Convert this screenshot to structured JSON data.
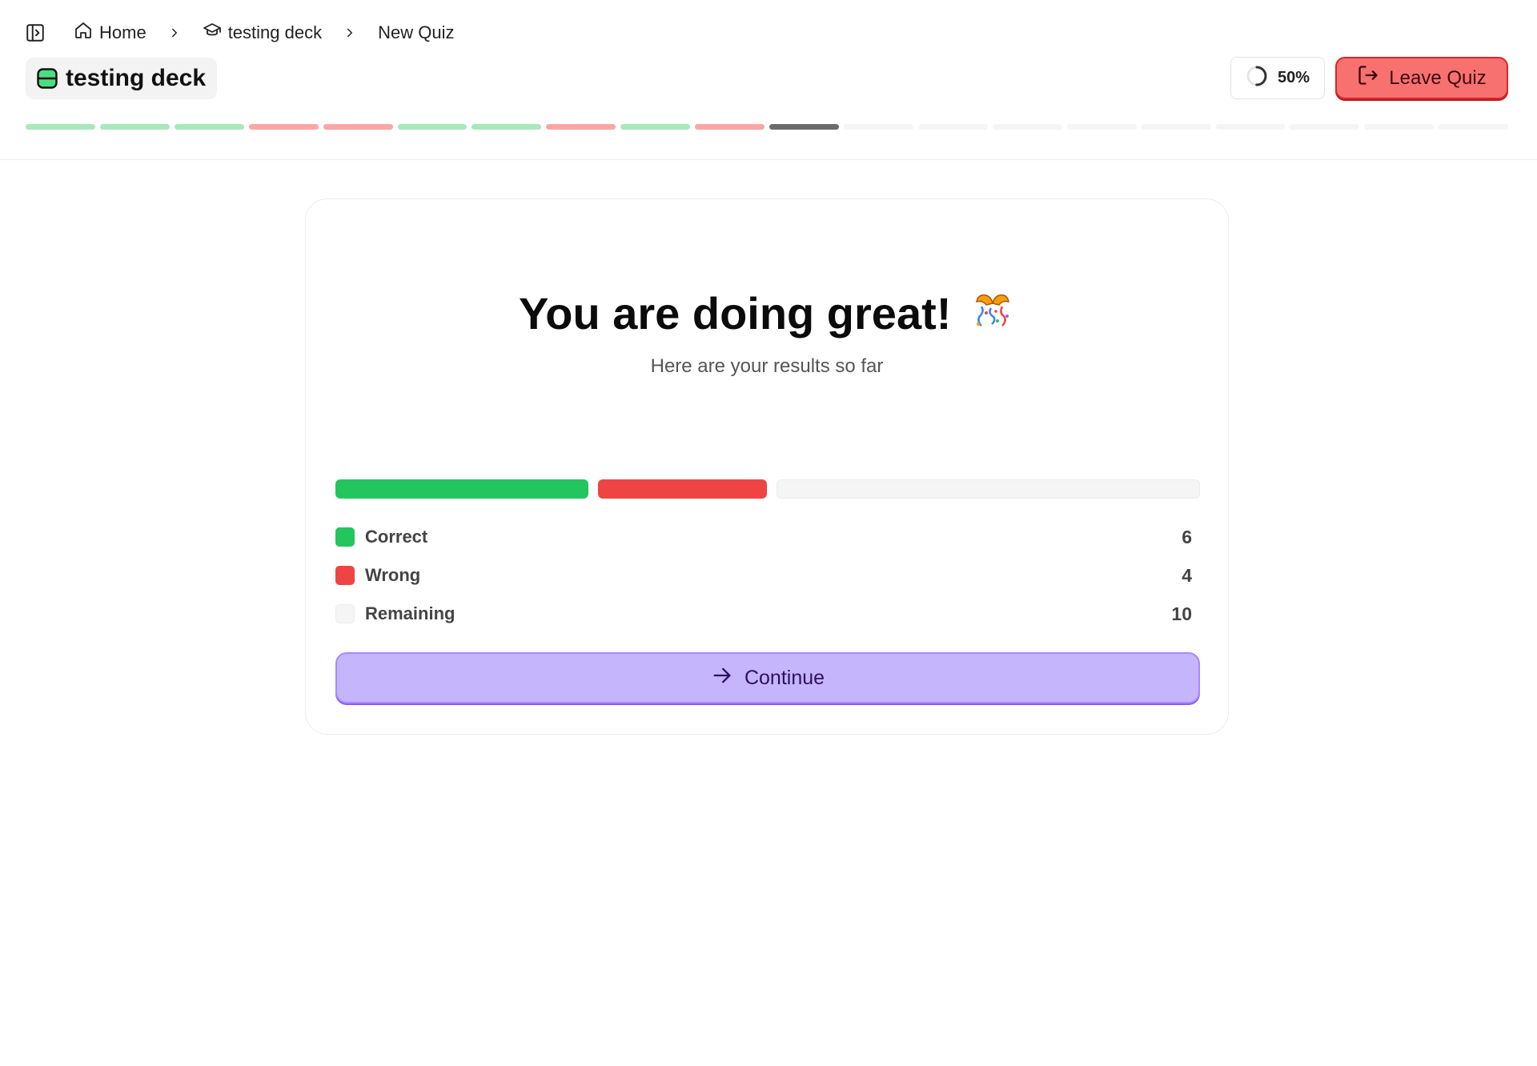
{
  "breadcrumb": {
    "home_label": "Home",
    "deck_label": "testing deck",
    "quiz_label": "New Quiz"
  },
  "header": {
    "deck_title": "testing deck",
    "progress_percent": 50,
    "progress_label": "50%",
    "leave_label": "Leave Quiz"
  },
  "question_segments": [
    "correct",
    "correct",
    "correct",
    "wrong",
    "wrong",
    "correct",
    "correct",
    "wrong",
    "correct",
    "wrong",
    "current",
    "remaining",
    "remaining",
    "remaining",
    "remaining",
    "remaining",
    "remaining",
    "remaining",
    "remaining",
    "remaining"
  ],
  "colors": {
    "correct": "#22c55e",
    "wrong": "#ef4444",
    "remaining": "#f5f5f5",
    "segment_correct": "#a7e8bd",
    "segment_wrong": "#fca5a5",
    "segment_current": "#6b6b6b",
    "segment_remaining": "#f5f5f5",
    "accent": "#c4b5fd"
  },
  "results": {
    "headline": "You are doing great!",
    "subheadline": "Here are your results so far",
    "items": [
      {
        "label": "Correct",
        "count": 6,
        "color": "#22c55e"
      },
      {
        "label": "Wrong",
        "count": 4,
        "color": "#ef4444"
      },
      {
        "label": "Remaining",
        "count": 10,
        "color": "#f5f5f5"
      }
    ]
  },
  "actions": {
    "continue_label": "Continue"
  },
  "icons": {
    "sidebar_toggle": "sidebar-toggle-icon",
    "home": "home-icon",
    "deck": "graduation-cap-icon",
    "chevron": "chevron-right-icon",
    "deck_chip": "deck-icon",
    "progress": "progress-ring-icon",
    "leave": "log-out-icon",
    "continue": "arrow-right-icon",
    "celebration": "party-popper-icon"
  }
}
